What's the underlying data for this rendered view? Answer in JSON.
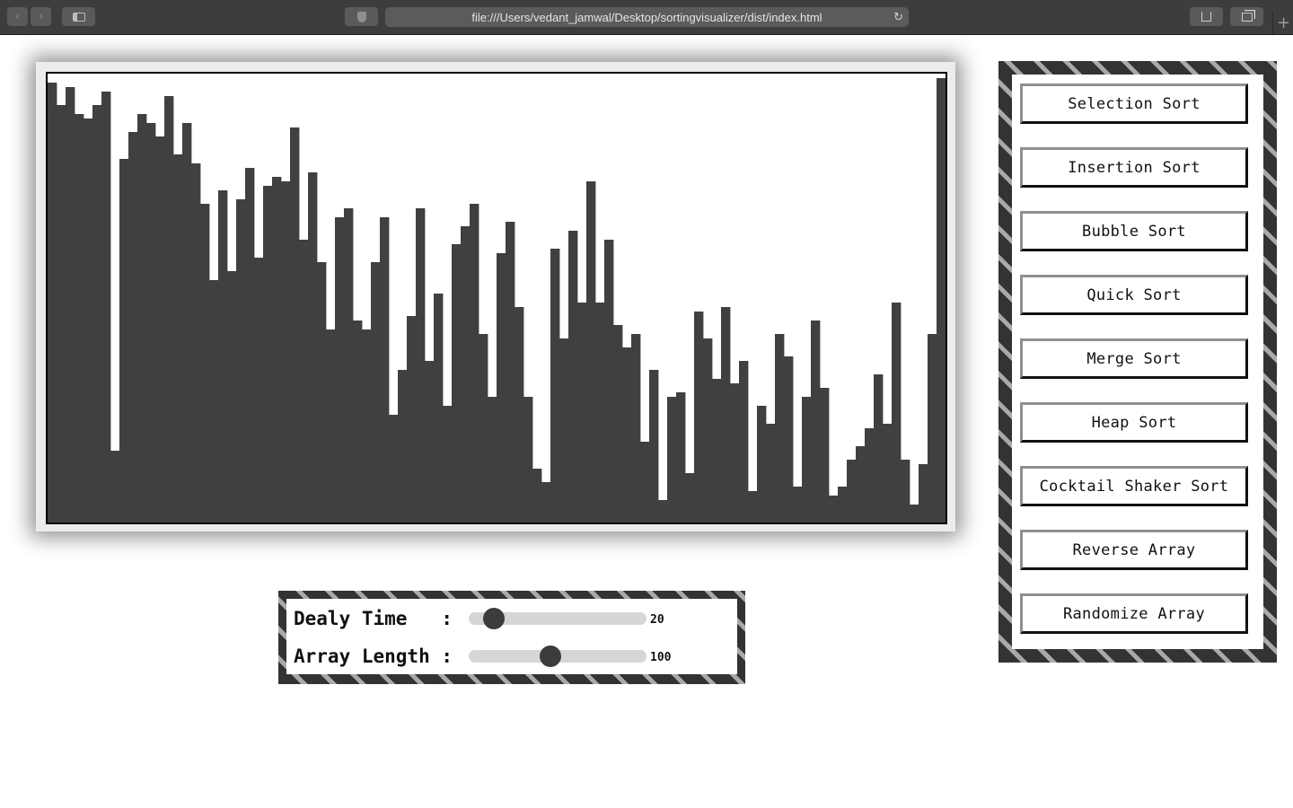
{
  "browser": {
    "url": "file:///Users/vedant_jamwal/Desktop/sortingvisualizer/dist/index.html"
  },
  "visualizer": {
    "bar_color": "#404040",
    "array_length": 100,
    "values": [
      98,
      93,
      97,
      91,
      90,
      93,
      96,
      16,
      81,
      87,
      91,
      89,
      86,
      95,
      82,
      89,
      80,
      71,
      54,
      74,
      56,
      72,
      79,
      59,
      75,
      77,
      76,
      88,
      63,
      78,
      58,
      43,
      68,
      70,
      45,
      43,
      58,
      68,
      24,
      34,
      46,
      70,
      36,
      51,
      26,
      62,
      66,
      71,
      42,
      28,
      60,
      67,
      48,
      28,
      12,
      9,
      61,
      41,
      65,
      49,
      76,
      49,
      63,
      44,
      39,
      42,
      18,
      34,
      5,
      28,
      29,
      11,
      47,
      41,
      32,
      48,
      31,
      36,
      7,
      26,
      22,
      42,
      37,
      8,
      28,
      45,
      30,
      6,
      8,
      14,
      17,
      21,
      33,
      22,
      49,
      14,
      4,
      13,
      42,
      99
    ]
  },
  "controls": {
    "delay": {
      "label": "Dealy Time   :",
      "value": "20",
      "fraction": 0.14
    },
    "length": {
      "label": "Array Length :",
      "value": "100",
      "fraction": 0.46
    }
  },
  "buttons": [
    {
      "label": "Selection Sort"
    },
    {
      "label": "Insertion Sort"
    },
    {
      "label": "Bubble Sort"
    },
    {
      "label": "Quick Sort"
    },
    {
      "label": "Merge Sort"
    },
    {
      "label": "Heap Sort"
    },
    {
      "label": "Cocktail Shaker Sort"
    },
    {
      "label": "Reverse Array"
    },
    {
      "label": "Randomize Array"
    }
  ]
}
